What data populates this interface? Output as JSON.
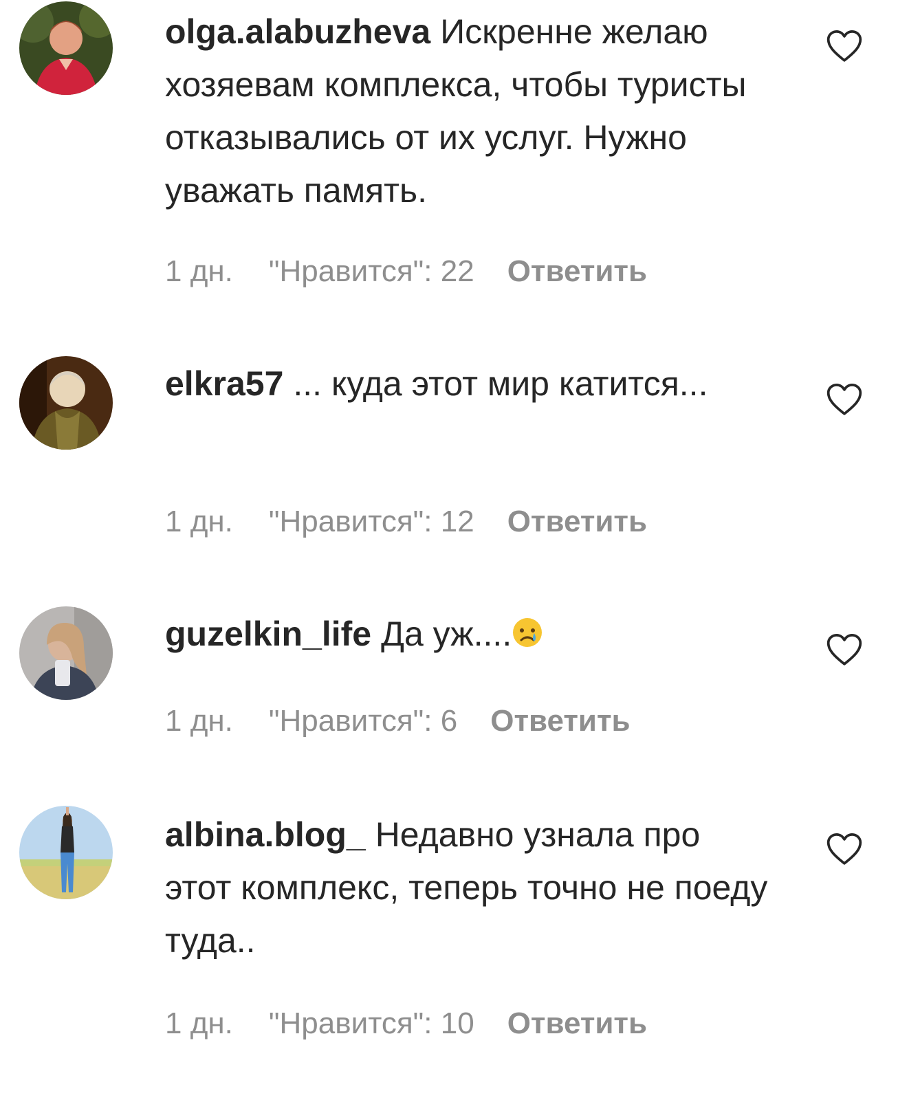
{
  "comments": [
    {
      "username": "olga.alabuzheva",
      "text": "Искренне желаю хозяевам комплекса, чтобы туристы отказывались от их услуг. Нужно уважать память.",
      "time": "1 дн.",
      "likes": "\"Нравится\": 22",
      "reply": "Ответить"
    },
    {
      "username": "elkra57",
      "text": "... куда этот мир катится...",
      "time": "1 дн.",
      "likes": "\"Нравится\": 12",
      "reply": "Ответить"
    },
    {
      "username": "guzelkin_life",
      "text": "Да уж....",
      "emoji": "crying-face-emoji",
      "time": "1 дн.",
      "likes": "\"Нравится\": 6",
      "reply": "Ответить"
    },
    {
      "username": "albina.blog_",
      "text": "Недавно узнала про этот комплекс, теперь точно не поеду туда..",
      "time": "1 дн.",
      "likes": "\"Нравится\": 10",
      "reply": "Ответить"
    }
  ],
  "icons": {
    "like": "heart-outline-icon"
  },
  "colors": {
    "text": "#262626",
    "meta": "#8e8e8e",
    "background": "#ffffff"
  }
}
